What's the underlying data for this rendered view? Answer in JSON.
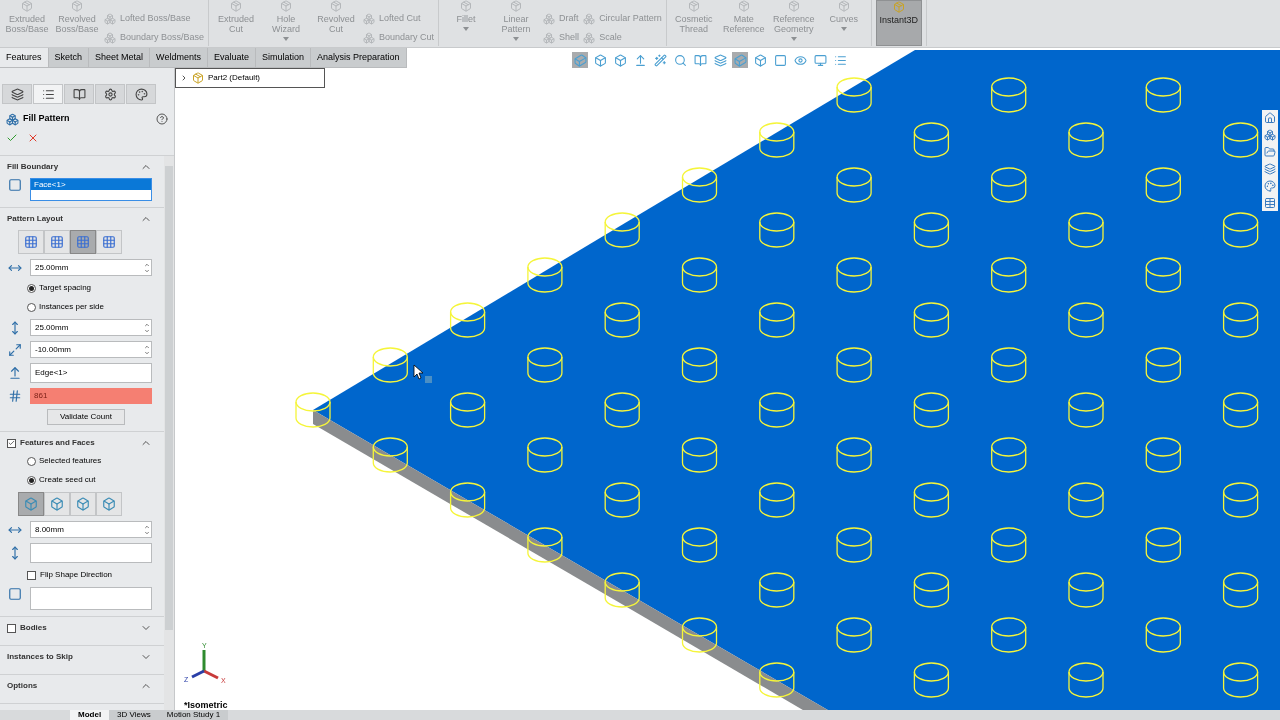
{
  "ribbon": {
    "groups": [
      {
        "items": [
          {
            "kind": "large",
            "label": "Extruded Boss/Base",
            "dropdown": false,
            "selected": false
          },
          {
            "kind": "large",
            "label": "Revolved Boss/Base",
            "dropdown": false,
            "selected": false
          },
          {
            "kind": "column",
            "entries": [
              "Lofted Boss/Base",
              "Boundary Boss/Base"
            ]
          }
        ]
      },
      {
        "items": [
          {
            "kind": "large",
            "label": "Extruded Cut",
            "dropdown": false,
            "selected": false
          },
          {
            "kind": "large",
            "label": "Hole Wizard",
            "dropdown": true,
            "selected": false
          },
          {
            "kind": "large",
            "label": "Revolved Cut",
            "dropdown": false,
            "selected": false
          },
          {
            "kind": "column",
            "entries": [
              "Lofted Cut",
              "Boundary Cut"
            ]
          }
        ]
      },
      {
        "items": [
          {
            "kind": "large",
            "label": "Fillet",
            "dropdown": true,
            "selected": false
          },
          {
            "kind": "large",
            "label": "Linear Pattern",
            "dropdown": true,
            "selected": false
          },
          {
            "kind": "column",
            "entries": [
              "Draft",
              "Shell"
            ]
          },
          {
            "kind": "column",
            "entries": [
              "Circular Pattern",
              "Scale"
            ]
          }
        ]
      },
      {
        "items": [
          {
            "kind": "large",
            "label": "Cosmetic Thread",
            "dropdown": false,
            "selected": false
          },
          {
            "kind": "large",
            "label": "Mate Reference",
            "dropdown": false,
            "selected": false
          },
          {
            "kind": "large",
            "label": "Reference Geometry",
            "dropdown": true,
            "selected": false
          },
          {
            "kind": "large",
            "label": "Curves",
            "dropdown": true,
            "selected": false
          }
        ]
      },
      {
        "items": [
          {
            "kind": "large",
            "label": "Instant3D",
            "dropdown": false,
            "selected": true
          }
        ]
      }
    ]
  },
  "command_tabs": [
    {
      "label": "Features",
      "selected": true
    },
    {
      "label": "Sketch",
      "selected": false
    },
    {
      "label": "Sheet Metal",
      "selected": false
    },
    {
      "label": "Weldments",
      "selected": false
    },
    {
      "label": "Evaluate",
      "selected": false
    },
    {
      "label": "Simulation",
      "selected": false
    },
    {
      "label": "Analysis Preparation",
      "selected": false
    }
  ],
  "property_manager": {
    "tabs": [
      {
        "selected": false
      },
      {
        "selected": true
      },
      {
        "selected": false
      },
      {
        "selected": false
      },
      {
        "selected": false
      }
    ],
    "title": "Fill Pattern",
    "sections": [
      {
        "title": "Fill Boundary",
        "expanded": true,
        "items": [
          {
            "kind": "list",
            "value": "Face<1>",
            "selected": true
          }
        ]
      },
      {
        "title": "Pattern Layout",
        "expanded": true,
        "items": [
          {
            "kind": "layout",
            "buttons": [
              {
                "selected": false
              },
              {
                "selected": false
              },
              {
                "selected": true
              },
              {
                "selected": false
              }
            ]
          },
          {
            "kind": "number",
            "value": "25.00mm"
          },
          {
            "kind": "radio",
            "label": "Target spacing",
            "selected": true
          },
          {
            "kind": "radio",
            "label": "Instances per side",
            "selected": false
          },
          {
            "kind": "number",
            "value": "25.00mm"
          },
          {
            "kind": "number",
            "value": "-10.00mm"
          },
          {
            "kind": "text",
            "value": "Edge<1>"
          },
          {
            "kind": "count",
            "value": "861",
            "error": true
          },
          {
            "kind": "button",
            "label": "Validate Count"
          }
        ]
      },
      {
        "title": "Features and Faces",
        "checked": true,
        "expanded": true,
        "items": [
          {
            "kind": "radio",
            "label": "Selected features",
            "selected": false
          },
          {
            "kind": "radio",
            "label": "Create seed cut",
            "selected": true
          },
          {
            "kind": "shapes",
            "buttons": [
              {
                "selected": true
              },
              {
                "selected": false
              },
              {
                "selected": false
              },
              {
                "selected": false
              }
            ]
          },
          {
            "kind": "number",
            "value": "8.00mm"
          },
          {
            "kind": "text"
          },
          {
            "kind": "checkbox",
            "label": "Flip Shape Direction",
            "checked": false
          },
          {
            "kind": "list"
          }
        ]
      },
      {
        "title": "Bodies",
        "checked": false,
        "expanded": false
      },
      {
        "title": "Instances to Skip",
        "expanded": false
      },
      {
        "title": "Options",
        "expanded": true
      }
    ]
  },
  "feature_tree": {
    "label": "Part2 (Default)"
  },
  "view": {
    "orientation": "*Isometric",
    "axes": [
      "X",
      "Y",
      "Z"
    ]
  },
  "bottom_tabs": [
    {
      "label": "Model",
      "selected": true
    },
    {
      "label": "3D Views",
      "selected": false
    },
    {
      "label": "Motion Study 1",
      "selected": false
    }
  ]
}
